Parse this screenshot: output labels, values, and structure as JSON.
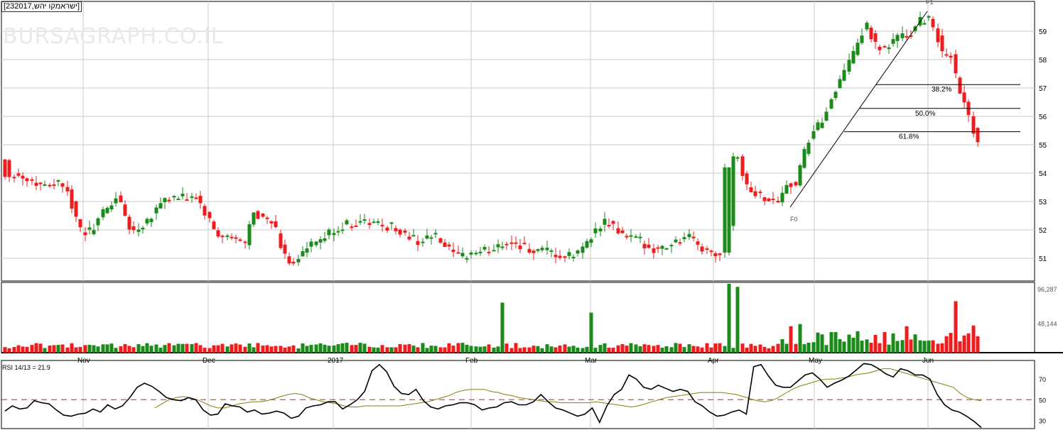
{
  "title": "[232017,ישראמקו יהש]",
  "watermark": "BURSAGRAPH.CO.IL",
  "rsi_label": "RSI 14/13 = 21.9",
  "colors": {
    "up": "#1a8a1a",
    "down": "#ee1c1c",
    "grid": "#c8c8c8",
    "rsi": "#000000",
    "rsi_signal": "#8a7a10",
    "rsi_ref": "#cc2222",
    "fib": "#000000"
  },
  "chart_data": [
    {
      "type": "candlestick",
      "panel": "price",
      "y_ticks": [
        "51",
        "52",
        "53",
        "54",
        "55",
        "56",
        "57",
        "58",
        "59"
      ],
      "ylim": [
        50.7,
        60.0
      ],
      "x_labels": [
        "Nov",
        "Dec",
        "2017",
        "Feb",
        "Mar",
        "Apr",
        "May",
        "Jun"
      ],
      "annotations": [
        "F0",
        "F1",
        "38.2%",
        "50.0%",
        "61.8%"
      ]
    },
    {
      "type": "bar",
      "panel": "volume",
      "y_ticks": [
        "96,287",
        "48,144"
      ],
      "ylim": [
        0,
        96287
      ]
    },
    {
      "type": "line",
      "panel": "rsi",
      "y_ticks": [
        "30",
        "50",
        "70"
      ],
      "ylim": [
        22,
        88
      ],
      "reference_line": 50,
      "series": [
        {
          "values": [
            39,
            44,
            41,
            42,
            49,
            47,
            46,
            40,
            35,
            34,
            36,
            37,
            41,
            38,
            45,
            41,
            44,
            52,
            62,
            66,
            63,
            58,
            52,
            50,
            49,
            52,
            50,
            40,
            35,
            36,
            46,
            44,
            43,
            38,
            40,
            36,
            37,
            39,
            37,
            32,
            34,
            42,
            44,
            45,
            48,
            48,
            41,
            45,
            50,
            58,
            78,
            84,
            77,
            63,
            56,
            55,
            60,
            49,
            43,
            41,
            44,
            45,
            47,
            47,
            45,
            40,
            42,
            43,
            47,
            48,
            45,
            45,
            48,
            55,
            48,
            42,
            40,
            37,
            34,
            36,
            42,
            28,
            44,
            55,
            60,
            74,
            70,
            62,
            60,
            64,
            61,
            58,
            60,
            58,
            48,
            44,
            38,
            34,
            35,
            38,
            40,
            36,
            82,
            84,
            73,
            64,
            62,
            62,
            68,
            74,
            76,
            70,
            62,
            66,
            69,
            73,
            79,
            85,
            84,
            80,
            75,
            72,
            80,
            78,
            74,
            74,
            70,
            55,
            45,
            40,
            38,
            34,
            29,
            23
          ]
        },
        {
          "values": [
            42,
            46,
            50,
            52,
            53,
            52,
            50,
            47,
            44,
            42,
            42,
            44,
            46,
            47,
            48,
            48,
            49,
            51,
            53,
            55,
            56,
            55,
            52,
            50,
            48,
            47,
            46,
            44,
            43,
            43,
            44,
            44,
            44,
            44,
            44,
            44,
            45,
            46,
            47,
            48,
            50,
            52,
            54,
            57,
            59,
            60,
            60,
            60,
            58,
            57,
            55,
            54,
            52,
            51,
            50,
            49,
            48,
            48,
            47,
            47,
            47,
            47,
            47,
            48,
            47,
            46,
            45,
            44,
            43,
            44,
            46,
            48,
            50,
            52,
            53,
            54,
            55,
            56,
            57,
            57,
            57,
            57,
            56,
            55,
            53,
            51,
            49,
            48,
            49,
            52,
            56,
            60,
            63,
            65,
            67,
            69,
            70,
            70,
            71,
            72,
            74,
            75,
            76,
            78,
            80,
            80,
            78,
            76,
            74,
            72,
            70,
            68,
            66,
            64,
            62,
            56,
            52,
            50,
            49
          ]
        }
      ]
    }
  ]
}
